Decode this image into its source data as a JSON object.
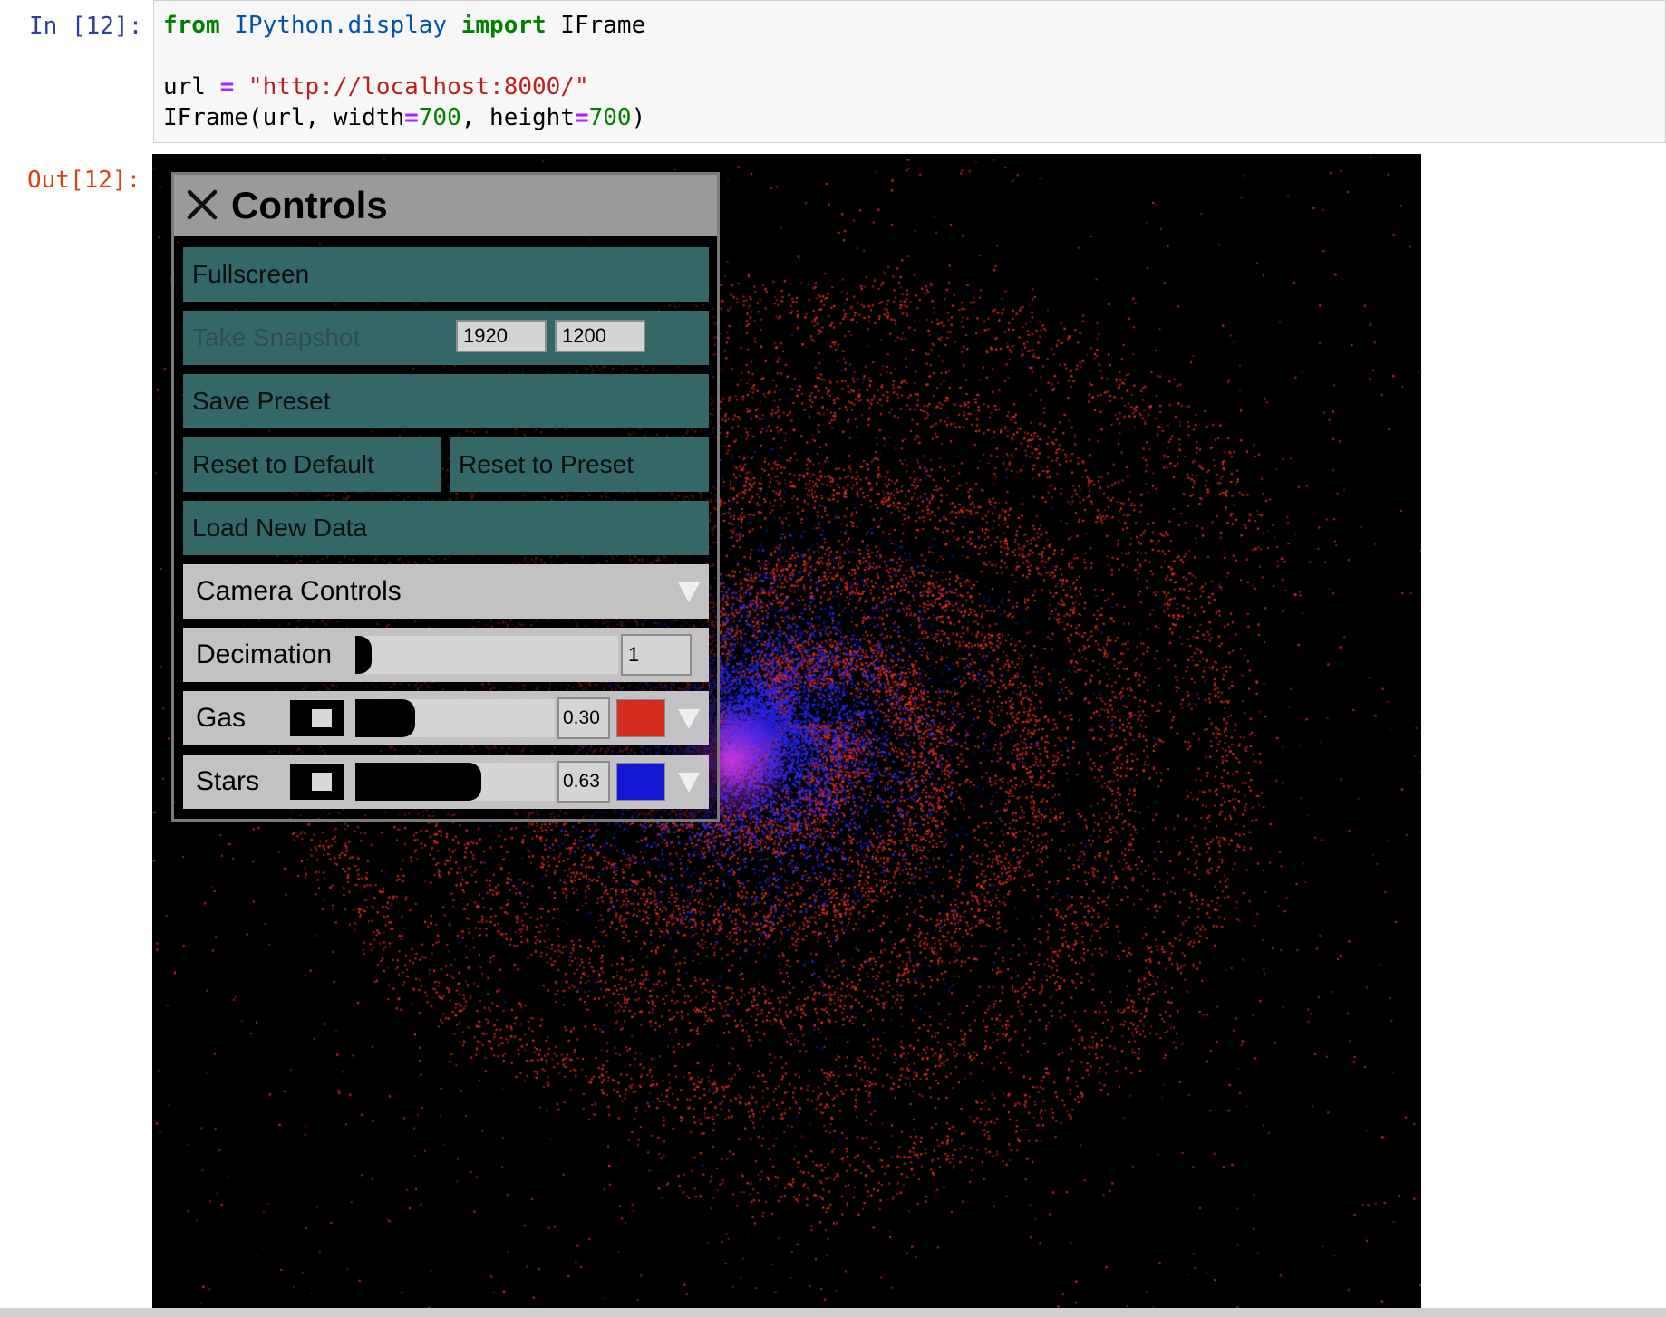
{
  "cell": {
    "in_prompt": "In [12]:",
    "out_prompt": "Out[12]:",
    "code": {
      "line1_kw1": "from",
      "line1_mod": " IPython.display ",
      "line1_kw2": "import",
      "line1_rest": " IFrame",
      "line3_var": "url ",
      "line3_eq": "=",
      "line3_str": " \"http://localhost:8000/\"",
      "line4_pre": "IFrame(url, width",
      "line4_eq1": "=",
      "line4_num1": "700",
      "line4_mid": ", height",
      "line4_eq2": "=",
      "line4_num2": "700",
      "line4_end": ")"
    }
  },
  "controls": {
    "title": "Controls",
    "fullscreen_label": "Fullscreen",
    "snapshot_label": "Take Snapshot",
    "snapshot_width": "1920",
    "snapshot_height": "1200",
    "save_preset_label": "Save Preset",
    "reset_default_label": "Reset to Default",
    "reset_preset_label": "Reset to Preset",
    "load_data_label": "Load New Data",
    "camera_controls_label": "Camera Controls",
    "decimation": {
      "label": "Decimation",
      "value": "1",
      "fraction": 0.02
    },
    "particles": [
      {
        "label": "Gas",
        "value": "0.30",
        "fraction": 0.3,
        "color": "#d52b20",
        "checked": true
      },
      {
        "label": "Stars",
        "value": "0.63",
        "fraction": 0.63,
        "color": "#1318d6",
        "checked": true
      }
    ]
  },
  "colors": {
    "gas": "#d52b20",
    "stars": "#1318d6",
    "button_bg": "#387070",
    "header_bg": "#9a9a9a"
  },
  "icons": [
    "close-icon",
    "chevron-down-icon",
    "checkbox-icon"
  ]
}
